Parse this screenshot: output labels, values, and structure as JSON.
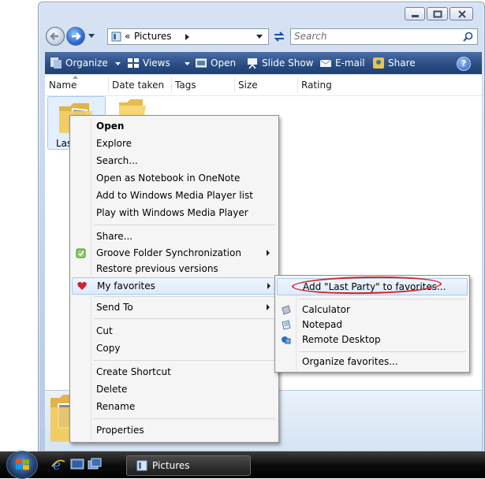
{
  "window": {
    "address_path": "Pictures",
    "address_prefix": "«",
    "search_placeholder": "Search"
  },
  "toolbar": {
    "organize": "Organize",
    "views": "Views",
    "open": "Open",
    "slide_show": "Slide Show",
    "email": "E-mail",
    "share": "Share"
  },
  "columns": [
    "Name",
    "Date taken",
    "Tags",
    "Size",
    "Rating"
  ],
  "files": [
    {
      "label": "Last"
    }
  ],
  "context_menu": {
    "items": [
      {
        "label": "Open"
      },
      {
        "label": "Explore"
      },
      {
        "label": "Search..."
      },
      {
        "label": "Open as Notebook in OneNote"
      },
      {
        "label": "Add to Windows Media Player list"
      },
      {
        "label": "Play with Windows Media Player"
      },
      {
        "label": "Share..."
      },
      {
        "label": "Groove Folder Synchronization"
      },
      {
        "label": "Restore previous versions"
      },
      {
        "label": "My favorites"
      },
      {
        "label": "Send To"
      },
      {
        "label": "Cut"
      },
      {
        "label": "Copy"
      },
      {
        "label": "Create Shortcut"
      },
      {
        "label": "Delete"
      },
      {
        "label": "Rename"
      },
      {
        "label": "Properties"
      }
    ]
  },
  "favorites_submenu": {
    "items": [
      {
        "label": "Add \"Last Party\" to favorites..."
      },
      {
        "label": "Calculator"
      },
      {
        "label": "Notepad"
      },
      {
        "label": "Remote Desktop"
      },
      {
        "label": "Organize favorites..."
      }
    ],
    "highlight_color": "#d42020"
  },
  "taskbar": {
    "task_label": "Pictures"
  },
  "colors": {
    "toolbar": "#2b4e86",
    "window_frame": "#c3d3ea",
    "menu_bg": "#f5f5f5"
  }
}
